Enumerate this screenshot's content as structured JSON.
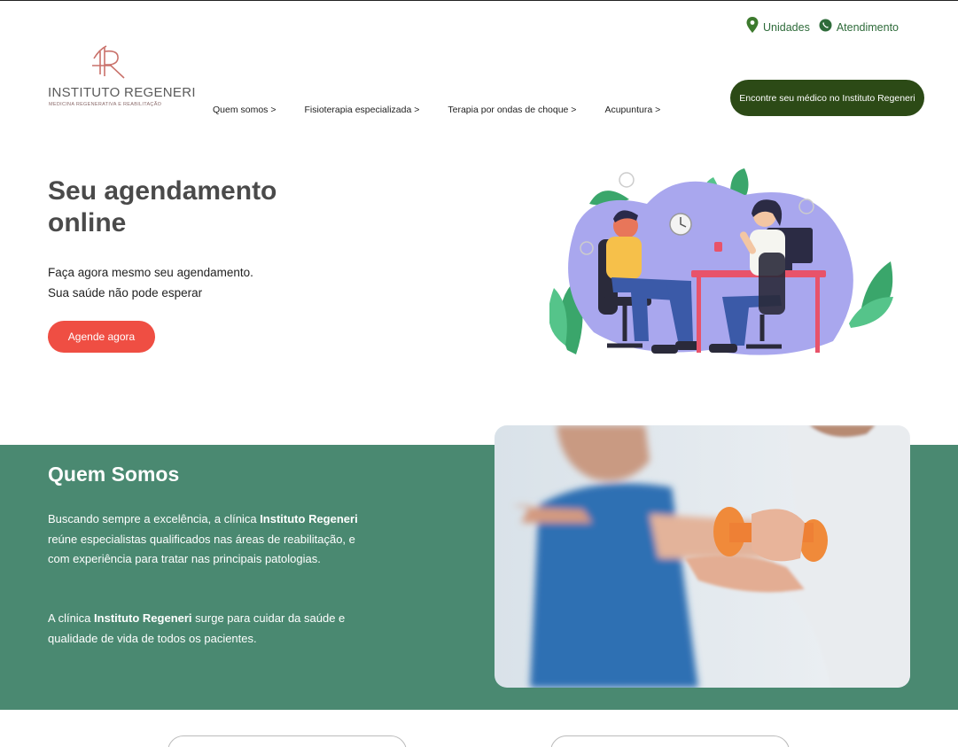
{
  "brand": {
    "name": "INSTITUTO REGENERI",
    "tagline": "MEDICINA REGENERATIVA E REABILITAÇÃO",
    "logo_color": "#c9716a"
  },
  "utility": {
    "units_label": "Unidades",
    "units_icon": "map-pin-icon",
    "contact_label": "Atendimento",
    "contact_icon": "whatsapp-icon",
    "color": "#2e6b3a"
  },
  "nav": {
    "items": [
      {
        "label": "Quem somos >"
      },
      {
        "label": "Fisioterapia especializada >"
      },
      {
        "label": "Terapia por ondas de choque >"
      },
      {
        "label": "Acupuntura >"
      }
    ]
  },
  "header_cta": {
    "label": "Encontre seu médico no Instituto Regeneri",
    "color": "#2c4a16"
  },
  "hero": {
    "title": "Seu agendamento online",
    "line1": "Faça agora mesmo seu agendamento.",
    "line2": "Sua saúde não pode esperar",
    "button": "Agende agora",
    "button_color": "#ef4e43"
  },
  "about": {
    "title": "Quem Somos",
    "p1_a": "Buscando sempre a excelência, a clínica ",
    "p1_b": "Instituto Regeneri",
    "p1_c": " reúne especialistas qualificados nas áreas de reabilitação, e com experiência para tratar nas principais patologias.",
    "p2_a": "A clínica ",
    "p2_b": "Instituto Regeneri",
    "p2_c": " surge para cuidar da saúde e qualidade de vida de todos os pacientes.",
    "bg_color": "#4a8971"
  }
}
